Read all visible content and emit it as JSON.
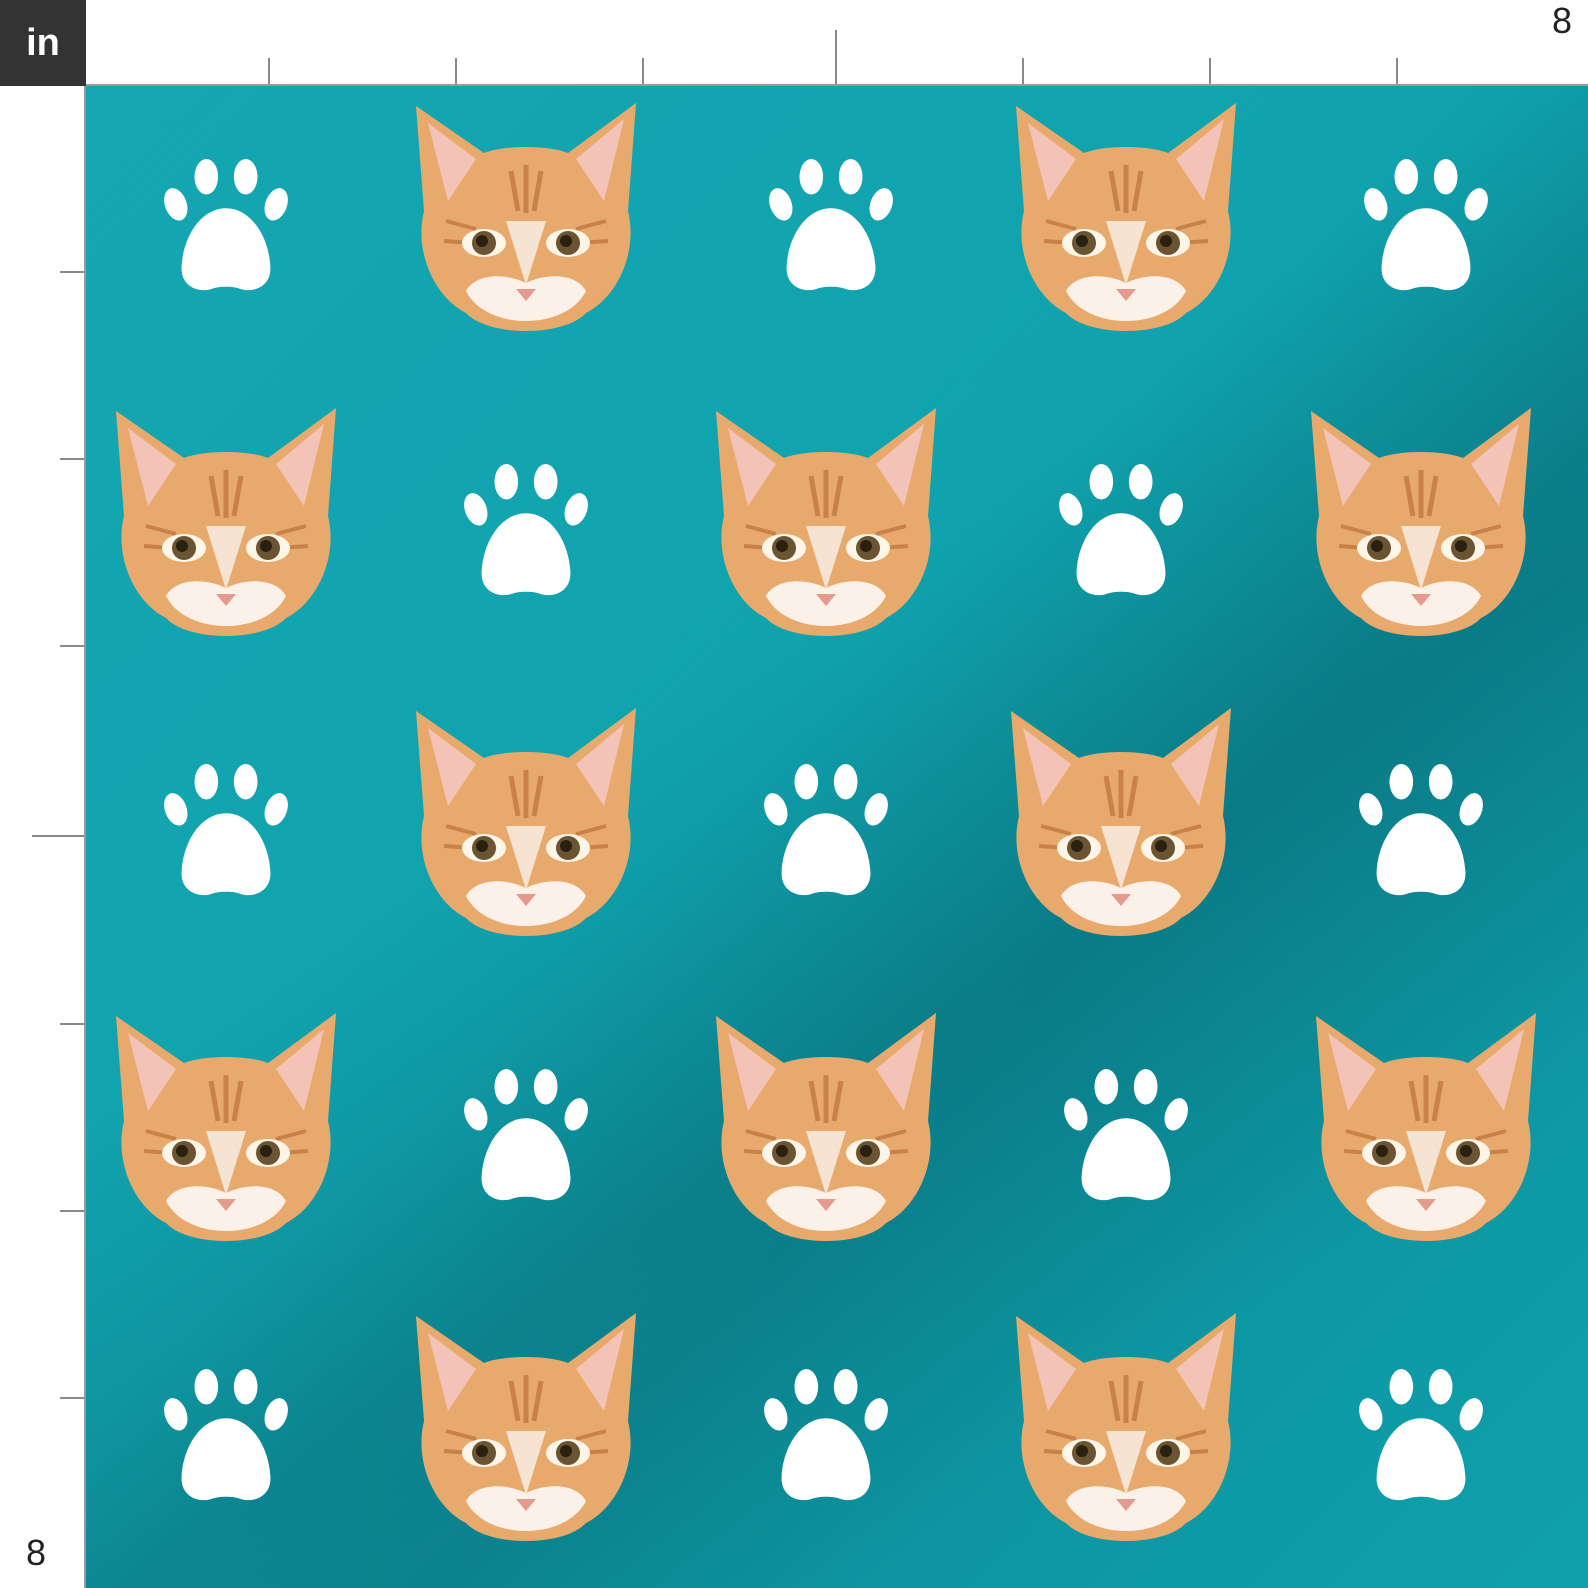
{
  "ruler": {
    "unit": "in",
    "top_end_label": "8",
    "left_end_label": "8"
  },
  "swatch": {
    "background_color": "#10a3ae",
    "motifs": [
      "cat-face-icon",
      "paw-print-icon"
    ]
  },
  "colors": {
    "teal": "#10a3ae",
    "paw": "#ffffff",
    "cat_fur": "#e5a766"
  }
}
